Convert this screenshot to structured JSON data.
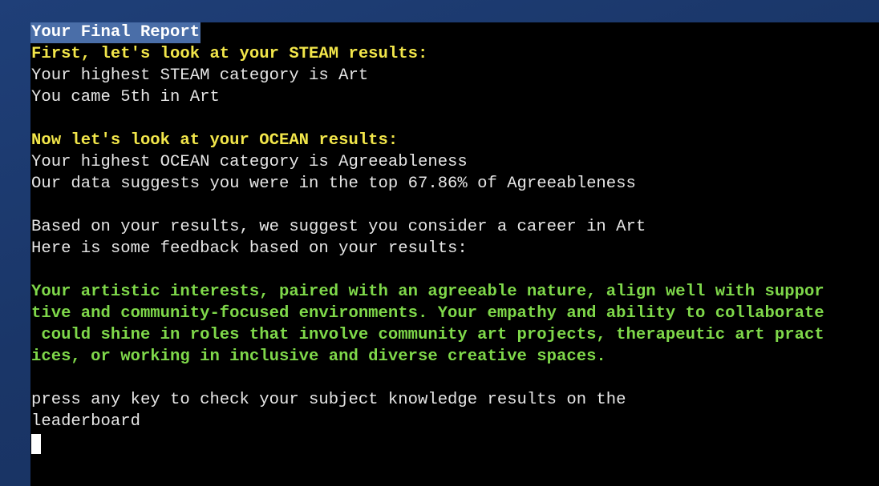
{
  "terminal": {
    "title": "Your Final Report",
    "steam": {
      "heading": "First, let's look at your STEAM results:",
      "highest": "Your highest STEAM category is Art",
      "place": "You came 5th in Art"
    },
    "ocean": {
      "heading": "Now let's look at your OCEAN results:",
      "highest": "Your highest OCEAN category is Agreeableness",
      "percentile": "Our data suggests you were in the top 67.86% of Agreeableness"
    },
    "suggestion": {
      "career": "Based on your results, we suggest you consider a career in Art",
      "intro": "Here is some feedback based on your results:"
    },
    "feedback_lines": [
      "Your artistic interests, paired with an agreeable nature, align well with suppor",
      "tive and community-focused environments. Your empathy and ability to collaborate",
      " could shine in roles that involve community art projects, therapeutic art pract",
      "ices, or working in inclusive and diverse creative spaces."
    ],
    "prompt_lines": [
      "press any key to check your subject knowledge results on the",
      "leaderboard"
    ]
  },
  "colors": {
    "heading": "#f2e64a",
    "feedback": "#7fd84a",
    "title_highlight": "#4a6ea8",
    "terminal_bg": "#000000"
  }
}
